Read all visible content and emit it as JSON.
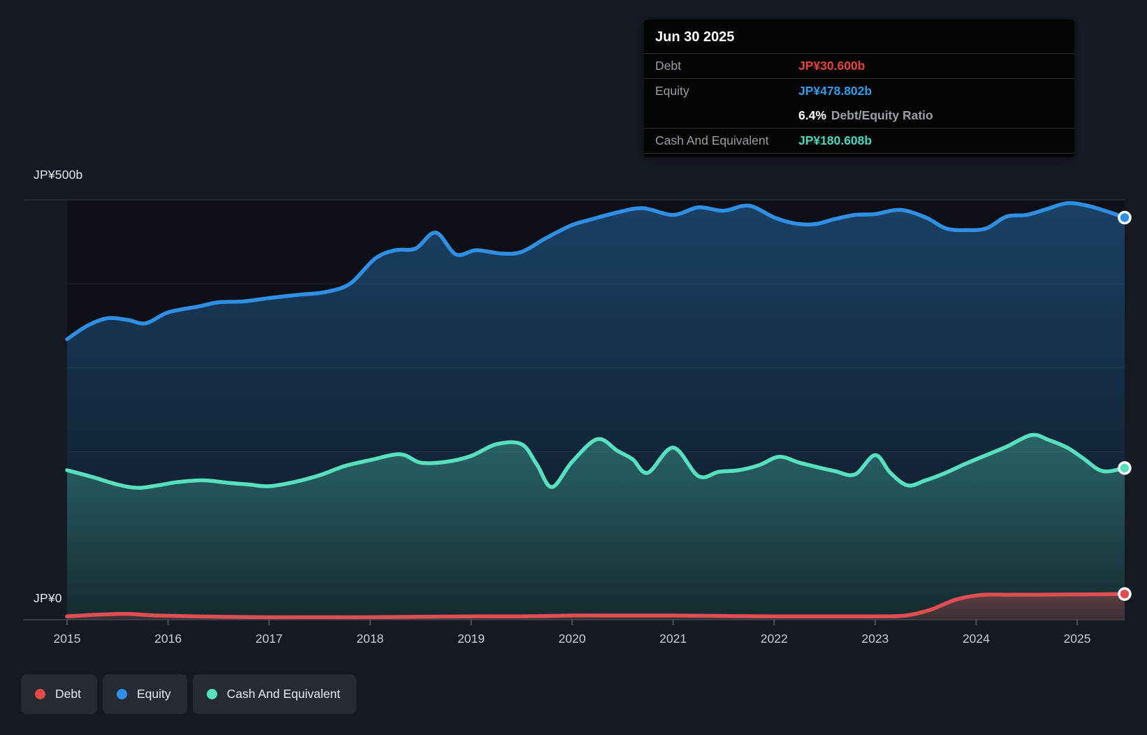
{
  "page": {
    "background": "#151921",
    "plot_background": "#0d1117"
  },
  "y_axis": {
    "top_label": "JP¥500b",
    "zero_label": "JP¥0"
  },
  "x_axis": {
    "ticks": [
      "2015",
      "2016",
      "2017",
      "2018",
      "2019",
      "2020",
      "2021",
      "2022",
      "2023",
      "2024",
      "2025"
    ]
  },
  "tooltip": {
    "date": "Jun 30 2025",
    "debt": {
      "label": "Debt",
      "value": "JP¥30.600b",
      "color": "#e8413b"
    },
    "equity": {
      "label": "Equity",
      "value": "JP¥478.802b",
      "color": "#2e9be8"
    },
    "ratio": {
      "value": "6.4%",
      "suffix": "Debt/Equity Ratio"
    },
    "cash": {
      "label": "Cash And Equivalent",
      "value": "JP¥180.608b",
      "color": "#46d8bb"
    }
  },
  "legend": {
    "items": [
      {
        "label": "Debt",
        "color": "#e24a48"
      },
      {
        "label": "Equity",
        "color": "#2f8fe4"
      },
      {
        "label": "Cash And Equivalent",
        "color": "#57e0bf"
      }
    ]
  },
  "chart_data": {
    "type": "area",
    "xlim": [
      2015,
      2025.47
    ],
    "ylim": [
      0,
      500
    ],
    "y_gridline_values": [
      100,
      200,
      300,
      400,
      500
    ],
    "y_axis_unit": "JP¥ billions",
    "legend_position": "bottom-left",
    "series": [
      {
        "name": "Equity",
        "color": "#2f8fe4",
        "points": [
          [
            2015.0,
            334
          ],
          [
            2015.2,
            350
          ],
          [
            2015.4,
            359
          ],
          [
            2015.6,
            357
          ],
          [
            2015.78,
            353
          ],
          [
            2016.0,
            366
          ],
          [
            2016.3,
            373
          ],
          [
            2016.5,
            378
          ],
          [
            2016.75,
            379
          ],
          [
            2017.0,
            383
          ],
          [
            2017.3,
            387
          ],
          [
            2017.55,
            390
          ],
          [
            2017.8,
            400
          ],
          [
            2018.05,
            430
          ],
          [
            2018.25,
            440
          ],
          [
            2018.45,
            442
          ],
          [
            2018.65,
            461
          ],
          [
            2018.85,
            435
          ],
          [
            2019.05,
            440
          ],
          [
            2019.3,
            436
          ],
          [
            2019.5,
            438
          ],
          [
            2019.75,
            455
          ],
          [
            2020.0,
            470
          ],
          [
            2020.2,
            477
          ],
          [
            2020.45,
            485
          ],
          [
            2020.7,
            490
          ],
          [
            2021.0,
            482
          ],
          [
            2021.25,
            491
          ],
          [
            2021.5,
            487
          ],
          [
            2021.75,
            493
          ],
          [
            2022.0,
            479
          ],
          [
            2022.2,
            472
          ],
          [
            2022.4,
            471
          ],
          [
            2022.6,
            477
          ],
          [
            2022.8,
            482
          ],
          [
            2023.0,
            483
          ],
          [
            2023.25,
            488
          ],
          [
            2023.5,
            479
          ],
          [
            2023.7,
            466
          ],
          [
            2023.9,
            464
          ],
          [
            2024.1,
            466
          ],
          [
            2024.3,
            480
          ],
          [
            2024.5,
            482
          ],
          [
            2024.7,
            489
          ],
          [
            2024.9,
            496
          ],
          [
            2025.1,
            493
          ],
          [
            2025.3,
            486
          ],
          [
            2025.47,
            478.802
          ]
        ]
      },
      {
        "name": "Cash And Equivalent",
        "color": "#57e0bf",
        "points": [
          [
            2015.0,
            178
          ],
          [
            2015.25,
            170
          ],
          [
            2015.5,
            161
          ],
          [
            2015.7,
            157
          ],
          [
            2015.9,
            160
          ],
          [
            2016.1,
            164
          ],
          [
            2016.35,
            166
          ],
          [
            2016.6,
            163
          ],
          [
            2016.8,
            161
          ],
          [
            2017.0,
            159
          ],
          [
            2017.25,
            164
          ],
          [
            2017.5,
            172
          ],
          [
            2017.75,
            183
          ],
          [
            2018.0,
            190
          ],
          [
            2018.3,
            197
          ],
          [
            2018.5,
            187
          ],
          [
            2018.75,
            188
          ],
          [
            2019.0,
            195
          ],
          [
            2019.25,
            209
          ],
          [
            2019.5,
            209
          ],
          [
            2019.65,
            185
          ],
          [
            2019.8,
            158
          ],
          [
            2020.0,
            188
          ],
          [
            2020.25,
            215
          ],
          [
            2020.45,
            201
          ],
          [
            2020.6,
            191
          ],
          [
            2020.75,
            175
          ],
          [
            2021.0,
            205
          ],
          [
            2021.25,
            171
          ],
          [
            2021.45,
            176
          ],
          [
            2021.65,
            178
          ],
          [
            2021.85,
            184
          ],
          [
            2022.05,
            194
          ],
          [
            2022.25,
            187
          ],
          [
            2022.45,
            181
          ],
          [
            2022.6,
            177
          ],
          [
            2022.8,
            173
          ],
          [
            2023.0,
            196
          ],
          [
            2023.15,
            175
          ],
          [
            2023.32,
            160
          ],
          [
            2023.5,
            166
          ],
          [
            2023.7,
            175
          ],
          [
            2023.9,
            186
          ],
          [
            2024.1,
            196
          ],
          [
            2024.3,
            206
          ],
          [
            2024.55,
            220
          ],
          [
            2024.72,
            214
          ],
          [
            2024.9,
            205
          ],
          [
            2025.05,
            193
          ],
          [
            2025.25,
            177
          ],
          [
            2025.47,
            180.608
          ]
        ]
      },
      {
        "name": "Debt",
        "color": "#df4e52",
        "points": [
          [
            2015.0,
            4
          ],
          [
            2015.3,
            6
          ],
          [
            2015.6,
            7
          ],
          [
            2015.9,
            5
          ],
          [
            2016.5,
            3.5
          ],
          [
            2017.0,
            3
          ],
          [
            2017.5,
            3
          ],
          [
            2018.0,
            3
          ],
          [
            2018.5,
            3.5
          ],
          [
            2019.0,
            4
          ],
          [
            2019.5,
            4
          ],
          [
            2020.0,
            5
          ],
          [
            2020.5,
            5
          ],
          [
            2021.0,
            5
          ],
          [
            2021.5,
            4.5
          ],
          [
            2022.0,
            4
          ],
          [
            2022.5,
            4
          ],
          [
            2023.0,
            4
          ],
          [
            2023.3,
            5
          ],
          [
            2023.55,
            12
          ],
          [
            2023.8,
            24
          ],
          [
            2024.05,
            29.5
          ],
          [
            2024.3,
            29.8
          ],
          [
            2024.6,
            29.8
          ],
          [
            2024.9,
            30
          ],
          [
            2025.2,
            30.3
          ],
          [
            2025.47,
            30.6
          ]
        ]
      }
    ]
  }
}
